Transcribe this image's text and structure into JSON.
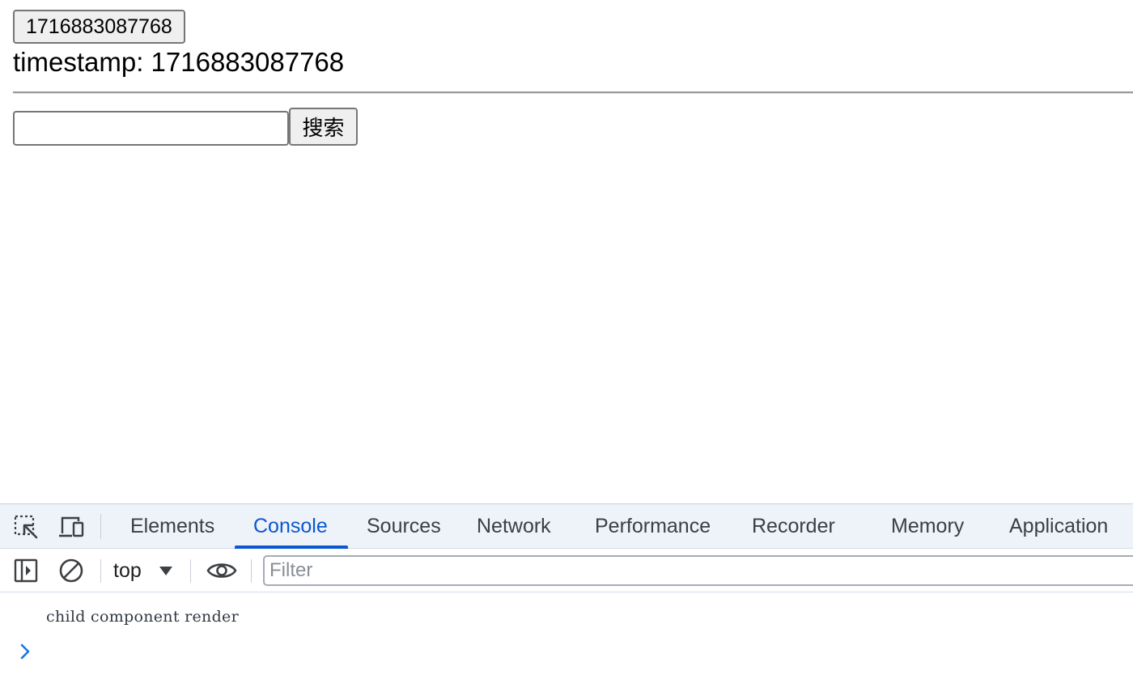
{
  "page": {
    "timestamp_button_label": "1716883087768",
    "timestamp_text": "timestamp: 1716883087768",
    "search_input_value": "",
    "search_button_label": "搜索"
  },
  "devtools": {
    "tabs": [
      {
        "label": "Elements",
        "active": false
      },
      {
        "label": "Console",
        "active": true
      },
      {
        "label": "Sources",
        "active": false
      },
      {
        "label": "Network",
        "active": false
      },
      {
        "label": "Performance",
        "active": false
      },
      {
        "label": "Recorder",
        "active": false
      },
      {
        "label": "Memory",
        "active": false
      },
      {
        "label": "Application",
        "active": false
      }
    ],
    "context_selector": "top",
    "filter_placeholder": "Filter",
    "console_logs": [
      "child component render"
    ],
    "accent_color": "#0b57d0"
  }
}
